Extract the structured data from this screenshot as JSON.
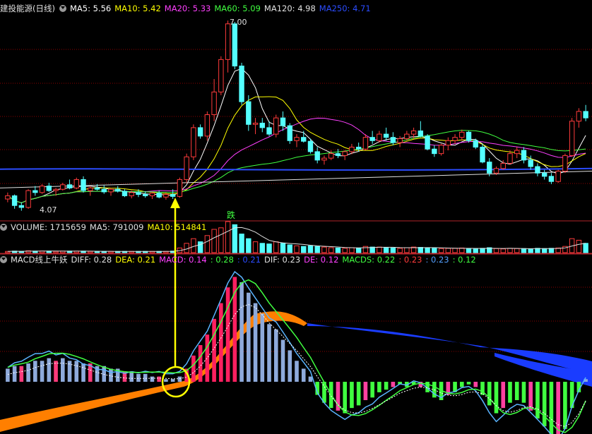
{
  "colors": {
    "bg": "#000000",
    "up": "#ff3b3b",
    "down": "#54ffff",
    "grid": "#8b0000",
    "panel_line": "#b0232a",
    "arrow": "#ffff00"
  },
  "main_panel": {
    "title": "建投能源(日线)",
    "indicators": [
      {
        "label": "MA5: 5.56",
        "color": "#ffffff"
      },
      {
        "label": "MA10: 5.42",
        "color": "#ffff00"
      },
      {
        "label": "MA20: 5.33",
        "color": "#ff40ff"
      },
      {
        "label": "MA60: 5.09",
        "color": "#40ff40"
      },
      {
        "label": "MA120: 4.98",
        "color": "#e0e0e0"
      },
      {
        "label": "MA250: 4.71",
        "color": "#2b4cff"
      }
    ],
    "high_label": "7.00",
    "low_label": "4.07",
    "marker_label": "跌"
  },
  "volume_panel": {
    "indicators": [
      {
        "label": "VOLUME: 1715659",
        "color": "#e0e0e0"
      },
      {
        "label": "MA5: 791009",
        "color": "#e0e0e0"
      },
      {
        "label": "MA10: 514841",
        "color": "#ffff00"
      }
    ]
  },
  "macd_panel": {
    "title": "MACD线上牛妖",
    "indicators": [
      {
        "label": "DIFF: 0.28",
        "color": "#e0e0e0"
      },
      {
        "label": "DEA: 0.21",
        "color": "#ffff00"
      },
      {
        "label": "MACD: 0.14",
        "color": "#ff40ff"
      },
      {
        "label": ": 0.28",
        "color": "#40ff40"
      },
      {
        "label": ": 0.21",
        "color": "#2b4cff"
      },
      {
        "label": "DIF: 0.23",
        "color": "#e0e0e0"
      },
      {
        "label": "DE: 0.12",
        "color": "#ff40ff"
      },
      {
        "label": "MACDS: 0.22",
        "color": "#40ff40"
      },
      {
        "label": ": 0.23",
        "color": "#ff3b3b"
      },
      {
        "label": ": 0.23",
        "color": "#54a0ff"
      },
      {
        "label": ": 0.12",
        "color": "#40ff40"
      }
    ]
  },
  "chart_data": {
    "type": "candlestick",
    "price_range": [
      4.0,
      7.1
    ],
    "candles": [
      [
        4.25,
        4.35,
        4.2,
        4.3
      ],
      [
        4.3,
        4.32,
        4.1,
        4.15
      ],
      [
        4.15,
        4.2,
        4.07,
        4.12
      ],
      [
        4.12,
        4.4,
        4.1,
        4.38
      ],
      [
        4.38,
        4.45,
        4.3,
        4.35
      ],
      [
        4.35,
        4.48,
        4.33,
        4.45
      ],
      [
        4.45,
        4.5,
        4.36,
        4.38
      ],
      [
        4.38,
        4.42,
        4.3,
        4.4
      ],
      [
        4.4,
        4.5,
        4.38,
        4.47
      ],
      [
        4.47,
        4.55,
        4.4,
        4.42
      ],
      [
        4.42,
        4.58,
        4.4,
        4.55
      ],
      [
        4.55,
        4.6,
        4.35,
        4.38
      ],
      [
        4.38,
        4.45,
        4.3,
        4.42
      ],
      [
        4.42,
        4.48,
        4.38,
        4.4
      ],
      [
        4.4,
        4.46,
        4.33,
        4.36
      ],
      [
        4.36,
        4.42,
        4.3,
        4.4
      ],
      [
        4.4,
        4.45,
        4.35,
        4.37
      ],
      [
        4.37,
        4.4,
        4.28,
        4.3
      ],
      [
        4.3,
        4.38,
        4.26,
        4.35
      ],
      [
        4.35,
        4.4,
        4.28,
        4.32
      ],
      [
        4.32,
        4.37,
        4.27,
        4.3
      ],
      [
        4.3,
        4.36,
        4.25,
        4.34
      ],
      [
        4.34,
        4.38,
        4.26,
        4.28
      ],
      [
        4.28,
        4.35,
        4.24,
        4.32
      ],
      [
        4.32,
        4.4,
        4.25,
        4.29
      ],
      [
        4.29,
        4.58,
        4.27,
        4.55
      ],
      [
        4.55,
        4.95,
        4.5,
        4.9
      ],
      [
        4.9,
        5.4,
        4.85,
        5.35
      ],
      [
        5.35,
        5.4,
        5.18,
        5.22
      ],
      [
        5.22,
        5.6,
        5.15,
        5.55
      ],
      [
        5.55,
        6.1,
        5.45,
        5.9
      ],
      [
        5.9,
        6.45,
        5.85,
        6.4
      ],
      [
        6.4,
        7.0,
        6.2,
        6.95
      ],
      [
        6.95,
        6.98,
        6.25,
        6.3
      ],
      [
        6.3,
        6.35,
        5.7,
        5.75
      ],
      [
        5.75,
        5.85,
        5.3,
        5.4
      ],
      [
        5.4,
        5.5,
        5.25,
        5.42
      ],
      [
        5.42,
        5.5,
        5.28,
        5.35
      ],
      [
        5.35,
        5.45,
        5.22,
        5.25
      ],
      [
        5.25,
        5.55,
        5.2,
        5.5
      ],
      [
        5.5,
        5.6,
        5.3,
        5.38
      ],
      [
        5.38,
        5.42,
        5.1,
        5.15
      ],
      [
        5.15,
        5.25,
        5.05,
        5.2
      ],
      [
        5.2,
        5.3,
        5.12,
        5.14
      ],
      [
        5.14,
        5.18,
        4.95,
        4.98
      ],
      [
        4.98,
        5.05,
        4.8,
        4.85
      ],
      [
        4.85,
        4.92,
        4.78,
        4.88
      ],
      [
        4.88,
        5.0,
        4.85,
        4.95
      ],
      [
        4.95,
        5.02,
        4.88,
        4.92
      ],
      [
        4.92,
        5.0,
        4.85,
        4.98
      ],
      [
        4.98,
        5.1,
        4.94,
        5.05
      ],
      [
        5.05,
        5.12,
        4.98,
        5.02
      ],
      [
        5.02,
        5.25,
        5.0,
        5.2
      ],
      [
        5.2,
        5.3,
        5.1,
        5.15
      ],
      [
        5.15,
        5.3,
        5.12,
        5.25
      ],
      [
        5.25,
        5.35,
        5.15,
        5.2
      ],
      [
        5.2,
        5.28,
        5.08,
        5.12
      ],
      [
        5.12,
        5.22,
        5.05,
        5.18
      ],
      [
        5.18,
        5.3,
        5.15,
        5.25
      ],
      [
        5.25,
        5.35,
        5.18,
        5.3
      ],
      [
        5.3,
        5.45,
        5.2,
        5.22
      ],
      [
        5.22,
        5.25,
        5.0,
        5.02
      ],
      [
        5.02,
        5.08,
        4.9,
        4.95
      ],
      [
        4.95,
        5.1,
        4.92,
        5.08
      ],
      [
        5.08,
        5.2,
        5.0,
        5.15
      ],
      [
        5.15,
        5.25,
        5.1,
        5.2
      ],
      [
        5.2,
        5.32,
        5.15,
        5.28
      ],
      [
        5.28,
        5.3,
        5.12,
        5.15
      ],
      [
        5.15,
        5.18,
        5.02,
        5.05
      ],
      [
        5.05,
        5.1,
        4.8,
        4.82
      ],
      [
        4.82,
        4.88,
        4.6,
        4.65
      ],
      [
        4.65,
        4.75,
        4.62,
        4.72
      ],
      [
        4.72,
        4.85,
        4.7,
        4.8
      ],
      [
        4.8,
        5.0,
        4.78,
        4.95
      ],
      [
        4.95,
        5.05,
        4.88,
        5.0
      ],
      [
        5.0,
        5.05,
        4.8,
        4.85
      ],
      [
        4.85,
        4.92,
        4.7,
        4.75
      ],
      [
        4.75,
        4.8,
        4.6,
        4.65
      ],
      [
        4.65,
        4.7,
        4.55,
        4.6
      ],
      [
        4.6,
        4.65,
        4.48,
        4.52
      ],
      [
        4.52,
        4.7,
        4.5,
        4.68
      ],
      [
        4.68,
        4.95,
        4.65,
        4.92
      ],
      [
        4.92,
        5.5,
        4.9,
        5.45
      ],
      [
        5.45,
        5.65,
        5.35,
        5.6
      ],
      [
        5.6,
        5.7,
        5.45,
        5.5
      ]
    ],
    "volume": [
      0.04,
      0.05,
      0.04,
      0.06,
      0.05,
      0.05,
      0.05,
      0.04,
      0.05,
      0.05,
      0.05,
      0.05,
      0.04,
      0.04,
      0.04,
      0.04,
      0.04,
      0.04,
      0.04,
      0.04,
      0.04,
      0.04,
      0.04,
      0.04,
      0.05,
      0.15,
      0.3,
      0.45,
      0.35,
      0.55,
      0.75,
      0.8,
      1.0,
      0.9,
      0.6,
      0.45,
      0.35,
      0.3,
      0.28,
      0.35,
      0.3,
      0.25,
      0.22,
      0.2,
      0.22,
      0.2,
      0.18,
      0.16,
      0.15,
      0.14,
      0.16,
      0.15,
      0.2,
      0.18,
      0.18,
      0.16,
      0.15,
      0.14,
      0.16,
      0.18,
      0.17,
      0.16,
      0.14,
      0.13,
      0.14,
      0.14,
      0.15,
      0.13,
      0.12,
      0.14,
      0.16,
      0.13,
      0.12,
      0.14,
      0.13,
      0.13,
      0.12,
      0.14,
      0.13,
      0.14,
      0.15,
      0.2,
      0.45,
      0.4,
      0.3
    ],
    "macd_bar_range": [
      -0.25,
      0.42
    ],
    "macd_bars": [
      0.05,
      0.06,
      0.06,
      0.07,
      0.08,
      0.08,
      0.09,
      0.08,
      0.09,
      0.08,
      0.08,
      0.07,
      0.07,
      0.06,
      0.06,
      0.05,
      0.05,
      0.04,
      0.04,
      0.03,
      0.03,
      0.02,
      0.02,
      0.01,
      0.01,
      0.02,
      0.05,
      0.1,
      0.14,
      0.18,
      0.24,
      0.3,
      0.36,
      0.4,
      0.38,
      0.34,
      0.3,
      0.26,
      0.22,
      0.2,
      0.16,
      0.12,
      0.08,
      0.05,
      0.02,
      -0.05,
      -0.08,
      -0.1,
      -0.11,
      -0.12,
      -0.1,
      -0.09,
      -0.07,
      -0.06,
      -0.04,
      -0.03,
      -0.02,
      -0.01,
      -0.02,
      -0.01,
      -0.02,
      -0.04,
      -0.06,
      -0.07,
      -0.05,
      -0.04,
      -0.02,
      -0.01,
      -0.02,
      -0.05,
      -0.09,
      -0.12,
      -0.1,
      -0.08,
      -0.07,
      -0.08,
      -0.11,
      -0.14,
      -0.17,
      -0.2,
      -0.22,
      -0.18,
      -0.1,
      -0.04,
      0.01
    ]
  }
}
